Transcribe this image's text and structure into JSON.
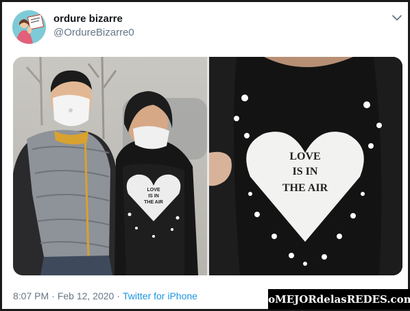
{
  "tweet": {
    "display_name": "ordure bizarre",
    "handle": "@OrdureBizarre0",
    "time": "8:07 PM",
    "separator": "·",
    "date": "Feb 12, 2020",
    "source": "Twitter for iPhone"
  },
  "photos": {
    "left": {
      "shirt_text_lines": [
        "LOVE",
        "IS IN",
        "THE AIR"
      ]
    },
    "right": {
      "shirt_text_lines": [
        "LOVE",
        "IS IN",
        "THE AIR"
      ]
    }
  },
  "icons": {
    "menu": "chevron-down-icon",
    "avatar": "avatar-illustration"
  },
  "colors": {
    "handle": "#657786",
    "source_link": "#1b95e0",
    "avatar_bg": "#7ecad6"
  },
  "watermark": {
    "text": "loMEJORdelasREDES.com"
  }
}
